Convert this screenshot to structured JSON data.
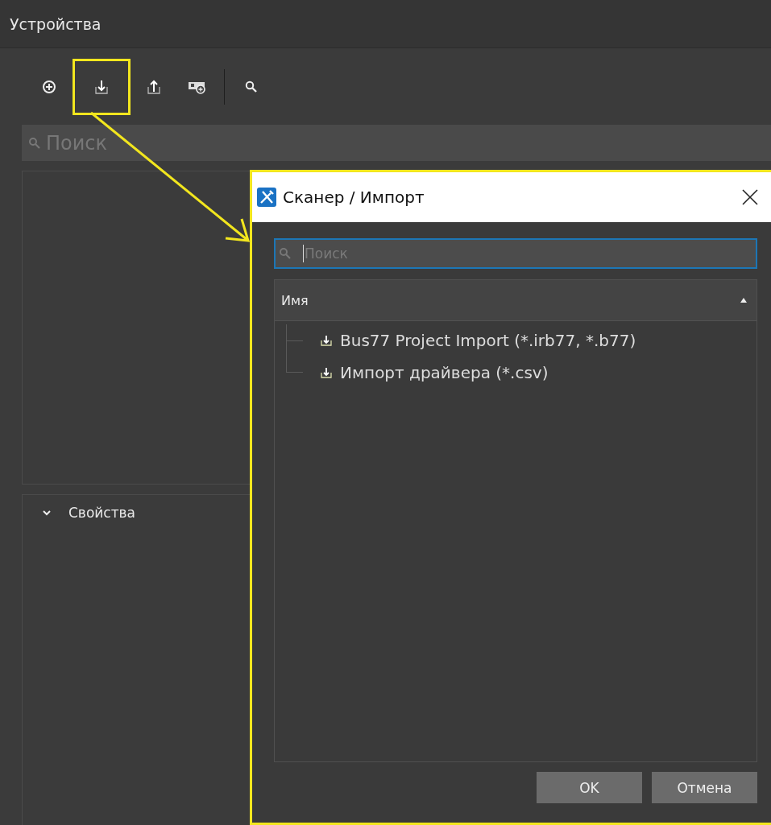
{
  "panel": {
    "title": "Устройства",
    "toolbar": [
      {
        "kind": "add",
        "highlighted": false
      },
      {
        "kind": "import",
        "highlighted": true
      },
      {
        "kind": "export",
        "highlighted": false
      },
      {
        "kind": "device",
        "highlighted": false
      },
      {
        "kind": "search",
        "highlighted": false
      }
    ],
    "search": {
      "placeholder": "Поиск"
    },
    "properties": {
      "label": "Свойства",
      "expanded": true
    }
  },
  "dialog": {
    "title": "Сканер / Импорт",
    "search": {
      "placeholder": "Поиск"
    },
    "column": "Имя",
    "items": [
      {
        "label": "Bus77 Project Import (*.irb77, *.b77)"
      },
      {
        "label": "Импорт драйвера (*.csv)"
      }
    ],
    "buttons": [
      "OK",
      "Отмена"
    ]
  }
}
